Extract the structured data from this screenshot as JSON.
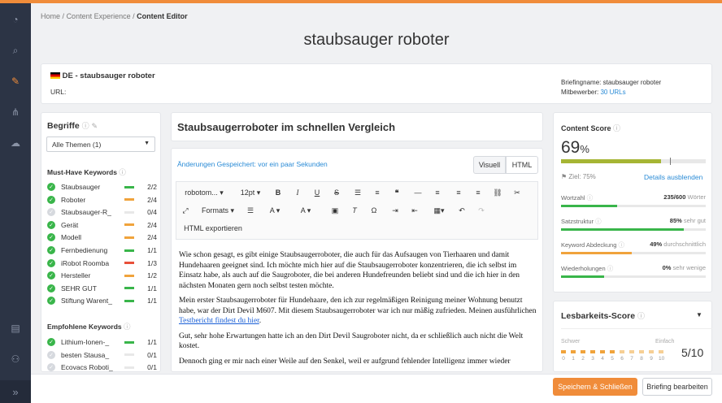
{
  "breadcrumb": {
    "home": "Home",
    "sep": "/",
    "section": "Content Experience",
    "current": "Content Editor"
  },
  "page_title": "staubsauger roboter",
  "brief": {
    "lang_title": "DE - staubsauger roboter",
    "url_label": "URL:",
    "briefing_label": "Briefingname:",
    "briefing_value": "staubsauger roboter",
    "competitors_label": "Mitbewerber:",
    "competitors_value": "30 URLs"
  },
  "terms": {
    "title": "Begriffe",
    "topic_select": "Alle Themen (1)",
    "must_have_title": "Must-Have Keywords",
    "must_have": [
      {
        "name": "Staubsauger",
        "count": "2/2",
        "done": true,
        "bar": "#39b54a"
      },
      {
        "name": "Roboter",
        "count": "2/4",
        "done": true,
        "bar": "#f0a33c"
      },
      {
        "name": "Staubsauger-R_",
        "count": "0/4",
        "done": false,
        "bar": "#e8e8e8"
      },
      {
        "name": "Gerät",
        "count": "2/4",
        "done": true,
        "bar": "#f0a33c"
      },
      {
        "name": "Modell",
        "count": "2/4",
        "done": true,
        "bar": "#f0a33c"
      },
      {
        "name": "Fernbedienung",
        "count": "1/1",
        "done": true,
        "bar": "#39b54a"
      },
      {
        "name": "iRobot Roomba",
        "count": "1/3",
        "done": true,
        "bar": "#e8503a"
      },
      {
        "name": "Hersteller",
        "count": "1/2",
        "done": true,
        "bar": "#f0a33c"
      },
      {
        "name": "SEHR GUT",
        "count": "1/1",
        "done": true,
        "bar": "#39b54a"
      },
      {
        "name": "Stiftung Warent_",
        "count": "1/1",
        "done": true,
        "bar": "#39b54a"
      }
    ],
    "recommended_title": "Empfohlene Keywords",
    "recommended": [
      {
        "name": "Lithium-Ionen-_",
        "count": "1/1",
        "done": true,
        "bar": "#39b54a"
      },
      {
        "name": "besten Stausa_",
        "count": "0/1",
        "done": false,
        "bar": "#e8e8e8"
      },
      {
        "name": "Ecovacs Roboti_",
        "count": "0/1",
        "done": false,
        "bar": "#e8e8e8"
      }
    ]
  },
  "editor": {
    "heading": "Staubsaugerroboter im schnellen Vergleich",
    "saved_status": "Änderungen Gespeichert: vor ein paar Sekunden",
    "tab_visual": "Visuell",
    "tab_html": "HTML",
    "font_select": "robotom...",
    "size_select": "12pt",
    "formats_label": "Formats",
    "export_label": "HTML exportieren",
    "p1": "Wie schon gesagt, es gibt einige Staubsaugerroboter, die auch für das Aufsaugen von Tierhaaren und damit Hundehaaren geeignet sind. Ich möchte mich hier auf die Staubsaugerroboter konzentrieren, die ich selbst im Einsatz habe, als auch auf die Saugroboter, die bei anderen Hundefreunden beliebt sind und die ich hier in den nächsten Monaten gern noch selbst testen möchte.",
    "p2": "Mein erster Staubsaugerroboter für Hundehaare, den ich zur regelmäßigen Reinigung meiner Wohnung benutzt habe, war der Dirt Devil M607. Mit diesem Staubsaugerroboter war ich nur mäßig zufrieden. Meinen ausführlichen",
    "p2_link": "Testbericht findest du hier",
    "p2_end": ".",
    "p3": "Gut, sehr hohe Erwartungen hatte ich an den Dirt Devil Saugroboter nicht, da er schließlich auch nicht die Welt kostet.",
    "p4": "Dennoch ging er mir nach einer Weile auf den Senkel, weil er aufgrund fehlender Intelligenz immer wieder"
  },
  "score": {
    "title": "Content Score",
    "value": "69",
    "unit": "%",
    "value_fraction": 0.69,
    "target_label": "Ziel: 75%",
    "target_fraction": 0.75,
    "hide_details": "Details ausblenden",
    "metrics": [
      {
        "label": "Wortzahl",
        "value": "235/600",
        "note": "Wörter",
        "fraction": 0.39,
        "color": "#39b54a"
      },
      {
        "label": "Satzstruktur",
        "value": "85%",
        "note": "sehr gut",
        "fraction": 0.85,
        "color": "#39b54a"
      },
      {
        "label": "Keyword Abdeckung",
        "value": "49%",
        "note": "durchschnittlich",
        "fraction": 0.49,
        "color": "#f0a33c"
      },
      {
        "label": "Wiederholungen",
        "value": "0%",
        "note": "sehr wenige",
        "fraction": 0.3,
        "color": "#39b54a"
      }
    ]
  },
  "readability": {
    "title": "Lesbarkeits-Score",
    "left_label": "Schwer",
    "right_label": "Einfach",
    "ticks": [
      "0",
      "1",
      "2",
      "3",
      "4",
      "5",
      "6",
      "7",
      "8",
      "9",
      "10"
    ],
    "value": "5/10",
    "value_fraction": 0.5
  },
  "footer": {
    "save_close": "Speichern & Schließen",
    "edit_briefing": "Briefing bearbeiten"
  },
  "colors": {
    "accent": "#f08c3a",
    "green": "#39b54a",
    "orange": "#f0a33c",
    "link": "#2a8bd6",
    "rail": "#2c3445"
  }
}
